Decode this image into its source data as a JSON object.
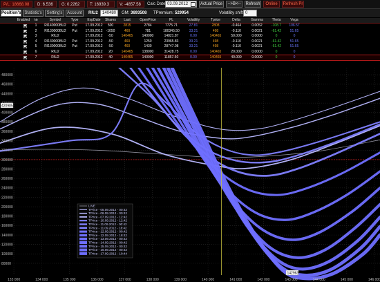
{
  "status": {
    "pl": "P/L: 18668.08",
    "d": "D: 6.536",
    "g": "G: 0.2262",
    "t": "T: 16939.3",
    "v": "V: -4857.58",
    "calc_label": "Calc Date:",
    "calc_date": "03.09.2012",
    "actual_price": "Actual Price",
    "arrow_btn": "-->B<--",
    "refresh": "Refresh",
    "online": "Online",
    "refresh_r": "Refresh Pr"
  },
  "toolbar": {
    "tabs": [
      "Position's",
      "Statistic's",
      "Setting's",
      "Account"
    ],
    "symbol": "RIU2",
    "price": "140480",
    "gm_label": "GM:",
    "gm_value": "3693508",
    "tpremium_label": "TPremium:",
    "tpremium_value": "529954",
    "vol_label": "Volatility shift:",
    "vol_value": "0"
  },
  "table": {
    "headers": [
      "Enabled",
      "№",
      "Symbol",
      "Type",
      "ExpDate",
      "Shares",
      "Last",
      "OpenPrice",
      "PL",
      "Volatility",
      "Tprice",
      "Delta",
      "Gamma",
      "Theta",
      "Vega"
    ],
    "rows": [
      [
        "1",
        "RI140000BU2",
        "Put",
        "17.09.2012",
        "500",
        "2815",
        "2784",
        "7775.71",
        "27.81",
        "2808",
        "-0.464",
        "0.0052",
        "-108.7",
        "106.57"
      ],
      [
        "2",
        "RI130000BU2",
        "Put",
        "17.09.2012",
        "-1050",
        "460",
        "781",
        "180345.50",
        "33.21",
        "498",
        "-0.110",
        "0.0021",
        "-61.42",
        "51.65"
      ],
      [
        "3",
        "RIU2",
        "",
        "17.09.2012",
        "-50",
        "140465",
        "140000",
        "14821.87",
        "0.00",
        "140465",
        "50.000",
        "0.0000",
        "0",
        "0"
      ],
      [
        "4",
        "RI130000BU2",
        "Put",
        "17.09.2012",
        "-50",
        "460",
        "1250",
        "23965.83",
        "33.21",
        "498",
        "-0.110",
        "0.0021",
        "-61.42",
        "51.65"
      ],
      [
        "5",
        "RI130000BU2",
        "Put",
        "17.09.2012",
        "-50",
        "460",
        "1430",
        "28747.08",
        "33.21",
        "498",
        "-0.110",
        "0.0021",
        "-61.42",
        "51.65"
      ],
      [
        "6",
        "RIU2",
        "",
        "17.09.2012",
        "20",
        "140465",
        "138000",
        "31428.75",
        "0.00",
        "140465",
        "20.000",
        "0.0000",
        "0",
        "0"
      ],
      [
        "7",
        "RIU2",
        "",
        "17.09.2012",
        "40",
        "140465",
        "140000",
        "11857.50",
        "0.00",
        "140465",
        "40.000",
        "0.0000",
        "0",
        "0"
      ]
    ]
  },
  "chart_data": {
    "type": "line",
    "xlim": [
      132500,
      146200
    ],
    "ylim": [
      55000,
      495000
    ],
    "x_ticks": [
      "133 000",
      "134 000",
      "135 000",
      "136 000",
      "137 000",
      "138 000",
      "139 000",
      "140 000",
      "141 000",
      "142 000",
      "143 000",
      "144 000",
      "145 000",
      "146 000"
    ],
    "y_ticks": [
      "480000",
      "460000",
      "440000",
      "420000",
      "400000",
      "380000",
      "360000",
      "340000",
      "320000",
      "300000",
      "280000",
      "260000",
      "240000",
      "220000",
      "200000",
      "180000",
      "160000",
      "140000",
      "120000",
      "100000",
      "80000"
    ],
    "current_price": 140480,
    "y_cursor_label": "420985",
    "x_cursor_label": "142963",
    "zero_line_y": 300000,
    "grid": true,
    "legend_position": "bottom-left",
    "series": [
      {
        "name": "LIVE",
        "values": [
          [
            132500,
            320000
          ],
          [
            134000,
            322000
          ],
          [
            136000,
            320000
          ],
          [
            138000,
            313000
          ],
          [
            140000,
            305000
          ],
          [
            140480,
            304000
          ],
          [
            142000,
            307000
          ],
          [
            144000,
            318000
          ],
          [
            146200,
            342000
          ]
        ]
      },
      {
        "name": "TPrice - 05.09.2012 - 00:42",
        "values": [
          [
            132500,
            380000
          ],
          [
            134000,
            430000
          ],
          [
            135500,
            452000
          ],
          [
            137000,
            432000
          ],
          [
            138500,
            398000
          ],
          [
            140000,
            370000
          ],
          [
            141000,
            362000
          ],
          [
            142000,
            367000
          ],
          [
            143000,
            382000
          ],
          [
            144500,
            410000
          ],
          [
            146200,
            445000
          ]
        ]
      },
      {
        "name": "TPrice - 06.09.2012 - 00:42",
        "values": [
          [
            132500,
            365000
          ],
          [
            134500,
            415000
          ],
          [
            136000,
            418000
          ],
          [
            137500,
            390000
          ],
          [
            139000,
            360000
          ],
          [
            140500,
            345000
          ],
          [
            141500,
            348000
          ],
          [
            143000,
            368000
          ],
          [
            144500,
            395000
          ],
          [
            146200,
            430000
          ]
        ]
      },
      {
        "name": "TPrice - 07.09.2012 - 12:42",
        "values": [
          [
            132500,
            335000
          ],
          [
            134500,
            368000
          ],
          [
            136500,
            355000
          ],
          [
            138500,
            310000
          ],
          [
            140500,
            285000
          ],
          [
            141500,
            282000
          ],
          [
            143000,
            300000
          ],
          [
            144500,
            332000
          ],
          [
            146200,
            372000
          ]
        ]
      },
      {
        "name": "TPrice - 10.09.2012 - 12:42",
        "values": [
          [
            132500,
            318000
          ],
          [
            135000,
            340000
          ],
          [
            136500,
            355000
          ],
          [
            137500,
            460000
          ],
          [
            138500,
            420000
          ],
          [
            139500,
            360000
          ],
          [
            140500,
            325000
          ],
          [
            141500,
            310000
          ],
          [
            142500,
            315000
          ],
          [
            144000,
            338000
          ],
          [
            146200,
            380000
          ]
        ]
      },
      {
        "name": "TPrice - 11.09.2012 - 00:42",
        "values": [
          [
            136800,
            495000
          ],
          [
            138000,
            430000
          ],
          [
            139000,
            365000
          ],
          [
            140000,
            320000
          ],
          [
            141000,
            298000
          ],
          [
            142000,
            294000
          ],
          [
            143000,
            305000
          ],
          [
            144500,
            335000
          ],
          [
            146200,
            375000
          ]
        ]
      },
      {
        "name": "TPrice - 11.09.2012 - 18:42",
        "values": [
          [
            137200,
            495000
          ],
          [
            138200,
            420000
          ],
          [
            139200,
            350000
          ],
          [
            140200,
            300000
          ],
          [
            141200,
            272000
          ],
          [
            142200,
            266000
          ],
          [
            143200,
            280000
          ],
          [
            144500,
            310000
          ],
          [
            146200,
            355000
          ]
        ]
      },
      {
        "name": "TPrice - 12.09.2012 - 00:42",
        "values": [
          [
            137500,
            495000
          ],
          [
            138500,
            410000
          ],
          [
            139500,
            330000
          ],
          [
            140500,
            270000
          ],
          [
            141500,
            235000
          ],
          [
            142500,
            225000
          ],
          [
            143500,
            238000
          ],
          [
            144800,
            270000
          ],
          [
            146200,
            315000
          ]
        ]
      },
      {
        "name": "TPrice - 12.09.2012 - 18:42",
        "values": [
          [
            137800,
            495000
          ],
          [
            138800,
            400000
          ],
          [
            139800,
            305000
          ],
          [
            140800,
            230000
          ],
          [
            141800,
            185000
          ],
          [
            142800,
            172000
          ],
          [
            143800,
            188000
          ],
          [
            145000,
            225000
          ],
          [
            146200,
            275000
          ]
        ]
      },
      {
        "name": "TPrice - 13.09.2012 - 00:42",
        "values": [
          [
            138000,
            495000
          ],
          [
            139000,
            395000
          ],
          [
            140000,
            290000
          ],
          [
            141000,
            205000
          ],
          [
            142000,
            150000
          ],
          [
            143000,
            130000
          ],
          [
            144000,
            145000
          ],
          [
            145200,
            190000
          ],
          [
            146200,
            240000
          ]
        ]
      },
      {
        "name": "TPrice - 14.09.2012 - 00:42",
        "values": [
          [
            138200,
            495000
          ],
          [
            139200,
            385000
          ],
          [
            140200,
            275000
          ],
          [
            141200,
            180000
          ],
          [
            142200,
            115000
          ],
          [
            143200,
            92000
          ],
          [
            144200,
            108000
          ],
          [
            145300,
            155000
          ],
          [
            146200,
            205000
          ]
        ]
      },
      {
        "name": "TPrice - 15.09.2012 - 00:42",
        "values": [
          [
            138400,
            495000
          ],
          [
            139400,
            378000
          ],
          [
            140400,
            262000
          ],
          [
            141400,
            160000
          ],
          [
            142400,
            92000
          ],
          [
            143300,
            68000
          ],
          [
            144300,
            82000
          ],
          [
            145400,
            128000
          ],
          [
            146200,
            178000
          ]
        ]
      },
      {
        "name": "TPrice - 16.09.2012 - 00:42",
        "values": [
          [
            138550,
            495000
          ],
          [
            139550,
            372000
          ],
          [
            140550,
            252000
          ],
          [
            141550,
            148000
          ],
          [
            142550,
            76000
          ],
          [
            143400,
            55000
          ],
          [
            144400,
            66000
          ],
          [
            145500,
            112000
          ],
          [
            146200,
            158000
          ]
        ]
      },
      {
        "name": "TPrice - 17.09.2012 - 10:44",
        "values": [
          [
            138700,
            495000
          ],
          [
            139700,
            368000
          ],
          [
            140700,
            245000
          ],
          [
            141700,
            140000
          ],
          [
            142700,
            65000
          ],
          [
            143500,
            48000
          ],
          [
            144500,
            58000
          ],
          [
            145600,
            100000
          ],
          [
            146200,
            140000
          ]
        ]
      }
    ]
  },
  "colors": {
    "line_light": "#b8b8ff",
    "line_mid": "#8080ff",
    "line_bold": "#6f6fff",
    "zero_line": "#ff2020",
    "price_line": "#c8c040"
  }
}
